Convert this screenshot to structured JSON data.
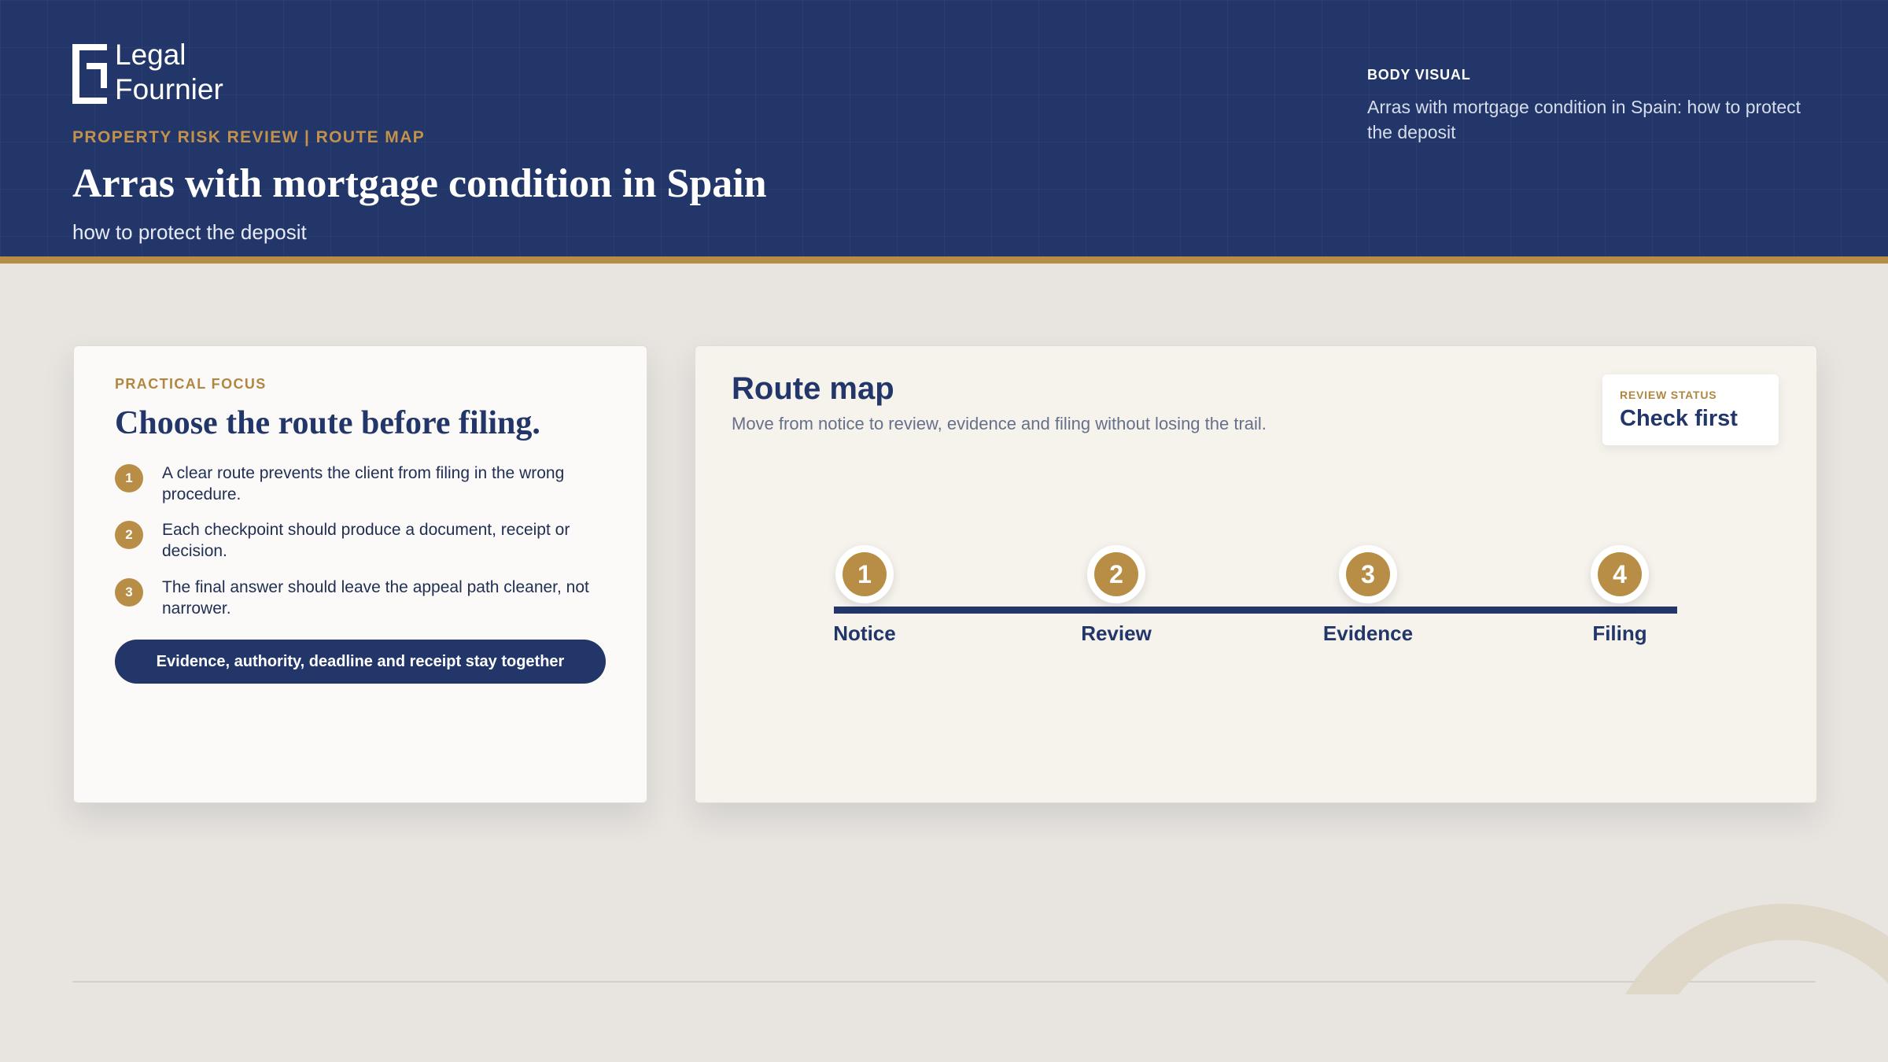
{
  "brand": {
    "line1": "Legal",
    "line2": "Fournier"
  },
  "header": {
    "kicker": "PROPERTY RISK REVIEW | ROUTE MAP",
    "title": "Arras with mortgage condition in Spain",
    "subtitle": "how to protect the deposit",
    "body_visual_label": "BODY VISUAL",
    "body_visual_text": "Arras with mortgage condition in Spain: how to protect the deposit"
  },
  "focus": {
    "label": "PRACTICAL FOCUS",
    "title": "Choose the route before filing.",
    "points": [
      {
        "num": "1",
        "text": "A clear route prevents the client from filing in the wrong procedure."
      },
      {
        "num": "2",
        "text": "Each checkpoint should produce a document, receipt or decision."
      },
      {
        "num": "3",
        "text": "The final answer should leave the appeal path cleaner, not narrower."
      }
    ],
    "pill": "Evidence, authority, deadline and receipt stay together"
  },
  "route": {
    "title": "Route map",
    "description": "Move from notice to review, evidence and filing without losing the trail.",
    "status_label": "REVIEW STATUS",
    "status_value": "Check first",
    "steps": [
      {
        "num": "1",
        "label": "Notice"
      },
      {
        "num": "2",
        "label": "Review"
      },
      {
        "num": "3",
        "label": "Evidence"
      },
      {
        "num": "4",
        "label": "Filing"
      }
    ]
  },
  "colors": {
    "navy": "#22366a",
    "gold": "#b88d45",
    "background": "#e8e5e0"
  }
}
